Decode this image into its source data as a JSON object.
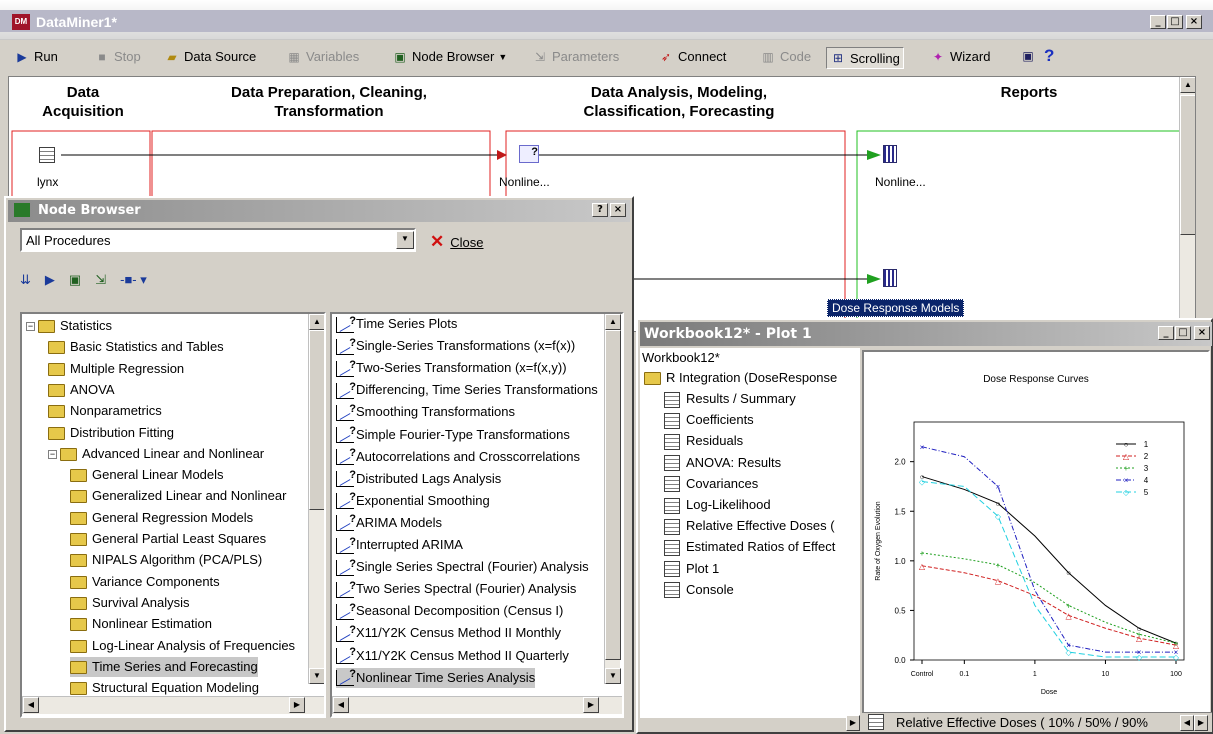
{
  "window": {
    "title": "DataMiner1*",
    "icon_text": "DM"
  },
  "toolbar": {
    "run": "Run",
    "stop": "Stop",
    "data_source": "Data Source",
    "variables": "Variables",
    "node_browser": "Node Browser",
    "parameters": "Parameters",
    "connect": "Connect",
    "code": "Code",
    "scrolling": "Scrolling",
    "wizard": "Wizard"
  },
  "workspace": {
    "stages": [
      "Data\nAcquisition",
      "Data Preparation, Cleaning,\nTransformation",
      "Data Analysis, Modeling,\nClassification, Forecasting",
      "Reports"
    ],
    "nodes": {
      "lynx": "lynx",
      "nonlinear1": "Nonline...",
      "nonlinear2": "Nonline...",
      "dose": "Dose Response Models"
    }
  },
  "node_browser": {
    "title": "Node Browser",
    "filter": "All Procedures",
    "close": "Close",
    "tree": [
      {
        "label": "Statistics",
        "level": 0,
        "box": "−"
      },
      {
        "label": "Basic Statistics and Tables",
        "level": 1
      },
      {
        "label": "Multiple Regression",
        "level": 1
      },
      {
        "label": "ANOVA",
        "level": 1
      },
      {
        "label": "Nonparametrics",
        "level": 1
      },
      {
        "label": "Distribution Fitting",
        "level": 1
      },
      {
        "label": "Advanced Linear and Nonlinear",
        "level": 1,
        "box": "−"
      },
      {
        "label": "General Linear Models",
        "level": 2
      },
      {
        "label": "Generalized Linear and Nonlinear",
        "level": 2
      },
      {
        "label": "General Regression Models",
        "level": 2
      },
      {
        "label": "General Partial Least Squares",
        "level": 2
      },
      {
        "label": "NIPALS Algorithm (PCA/PLS)",
        "level": 2
      },
      {
        "label": "Variance Components",
        "level": 2
      },
      {
        "label": "Survival Analysis",
        "level": 2
      },
      {
        "label": "Nonlinear Estimation",
        "level": 2
      },
      {
        "label": "Log-Linear Analysis of Frequencies",
        "level": 2
      },
      {
        "label": "Time Series and Forecasting",
        "level": 2,
        "selected": true
      },
      {
        "label": "Structural Equation Modeling",
        "level": 2
      }
    ],
    "procedures": [
      "Time Series Plots",
      "Single-Series Transformations (x=f(x))",
      "Two-Series Transformation (x=f(x,y))",
      "Differencing, Time Series Transformations",
      "Smoothing Transformations",
      "Simple Fourier-Type Transformations",
      "Autocorrelations and Crosscorrelations",
      "Distributed Lags Analysis",
      "Exponential Smoothing",
      "ARIMA Models",
      "Interrupted ARIMA",
      "Single Series Spectral (Fourier) Analysis",
      "Two Series Spectral (Fourier) Analysis",
      "Seasonal Decomposition (Census I)",
      "X11/Y2K Census Method II Monthly",
      "X11/Y2K Census Method II Quarterly",
      "Nonlinear Time Series Analysis"
    ]
  },
  "workbook": {
    "title": "Workbook12* - Plot 1",
    "root": "Workbook12*",
    "folder": "R Integration (DoseResponse",
    "items": [
      "Results / Summary",
      "Coefficients",
      "Residuals",
      "ANOVA: Results",
      "Covariances",
      "Log-Likelihood",
      "Relative Effective Doses (",
      "Estimated Ratios of Effect",
      "Plot 1",
      "Console"
    ],
    "status_tab": "Relative Effective Doses ( 10% / 50% / 90%"
  },
  "chart_data": {
    "type": "line",
    "title": "Dose Response Curves",
    "xlabel": "Dose",
    "ylabel": "Rate of Oxygen Evolution",
    "x_scale": "log",
    "x_ticks": [
      "Control",
      "0.1",
      "1",
      "10",
      "100"
    ],
    "y_ticks": [
      "0.0",
      "0.5",
      "1.0",
      "1.5",
      "2.0"
    ],
    "ylim": [
      0,
      2.4
    ],
    "legend": "top-right",
    "colors": [
      "#000000",
      "#d02020",
      "#20a020",
      "#2020c0",
      "#20d0e0"
    ],
    "x": [
      0,
      0.1,
      0.3,
      1,
      3,
      10,
      30,
      100
    ],
    "series": [
      {
        "name": "1",
        "values": [
          1.85,
          1.72,
          1.58,
          1.25,
          0.88,
          0.55,
          0.32,
          0.17
        ]
      },
      {
        "name": "2",
        "values": [
          0.95,
          0.88,
          0.8,
          0.65,
          0.45,
          0.32,
          0.22,
          0.15
        ]
      },
      {
        "name": "3",
        "values": [
          1.08,
          1.02,
          0.96,
          0.78,
          0.55,
          0.38,
          0.26,
          0.17
        ]
      },
      {
        "name": "4",
        "values": [
          2.15,
          2.05,
          1.75,
          0.7,
          0.15,
          0.08,
          0.08,
          0.08
        ]
      },
      {
        "name": "5",
        "values": [
          1.8,
          1.75,
          1.45,
          0.55,
          0.08,
          0.03,
          0.03,
          0.03
        ]
      }
    ]
  }
}
